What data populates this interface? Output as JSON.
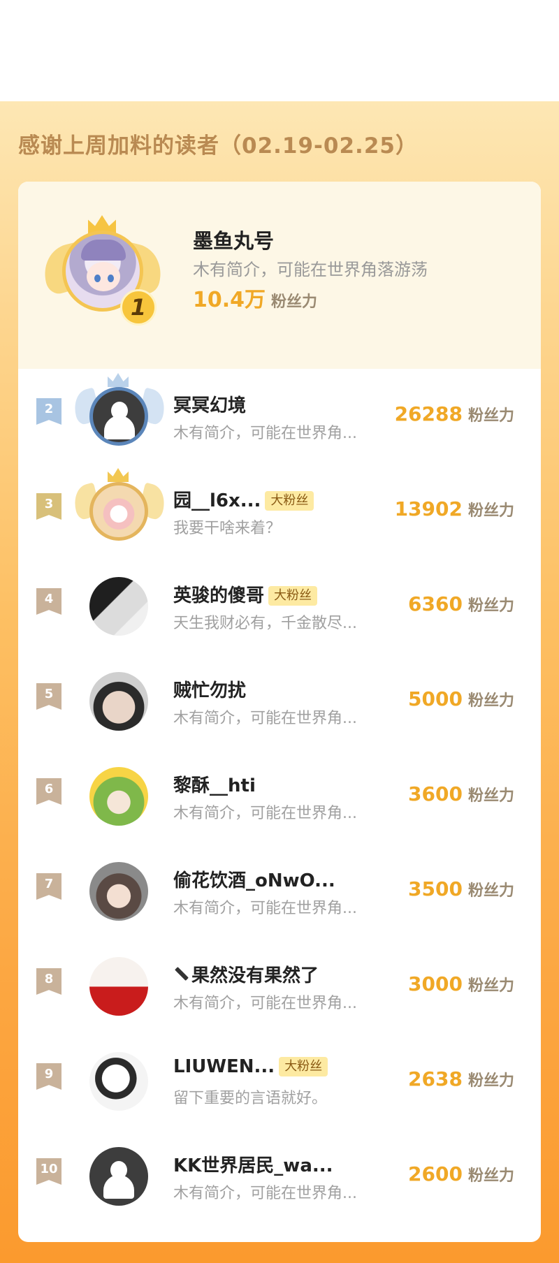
{
  "header": {
    "title": "感谢上周加料的读者（02.19-02.25）"
  },
  "top1": {
    "rank": "1",
    "name": "墨鱼丸号",
    "bio": "木有简介，可能在世界角落游荡",
    "score": "10.4万",
    "unit": "粉丝力"
  },
  "tag_label": "大粉丝",
  "rows": [
    {
      "rank": "2",
      "name": "冥冥幻境",
      "bio": "木有简介，可能在世界角...",
      "score": "26288",
      "unit": "粉丝力"
    },
    {
      "rank": "3",
      "name": "园__l6x...",
      "tag": "大粉丝",
      "bio": "我要干啥来着？",
      "score": "13902",
      "unit": "粉丝力"
    },
    {
      "rank": "4",
      "name": "英骏的傻哥",
      "tag": "大粉丝",
      "bio": "天生我财必有，千金散尽...",
      "score": "6360",
      "unit": "粉丝力"
    },
    {
      "rank": "5",
      "name": "贼忙勿扰",
      "bio": "木有简介，可能在世界角...",
      "score": "5000",
      "unit": "粉丝力"
    },
    {
      "rank": "6",
      "name": "黎酥__hti",
      "bio": "木有简介，可能在世界角...",
      "score": "3600",
      "unit": "粉丝力"
    },
    {
      "rank": "7",
      "name": "偷花饮酒_oNwO...",
      "bio": "木有简介，可能在世界角...",
      "score": "3500",
      "unit": "粉丝力"
    },
    {
      "rank": "8",
      "name": "果然没有果然了",
      "bio": "木有简介，可能在世界角...",
      "score": "3000",
      "unit": "粉丝力"
    },
    {
      "rank": "9",
      "name": "LIUWEN...",
      "tag": "大粉丝",
      "bio": "留下重要的言语就好。",
      "score": "2638",
      "unit": "粉丝力"
    },
    {
      "rank": "10",
      "name": "KK世界居民_wa...",
      "bio": "木有简介，可能在世界角...",
      "score": "2600",
      "unit": "粉丝力"
    }
  ],
  "colors": {
    "accent": "#f0a826",
    "title": "#b98a52",
    "tag_bg": "#fdeaa2"
  }
}
